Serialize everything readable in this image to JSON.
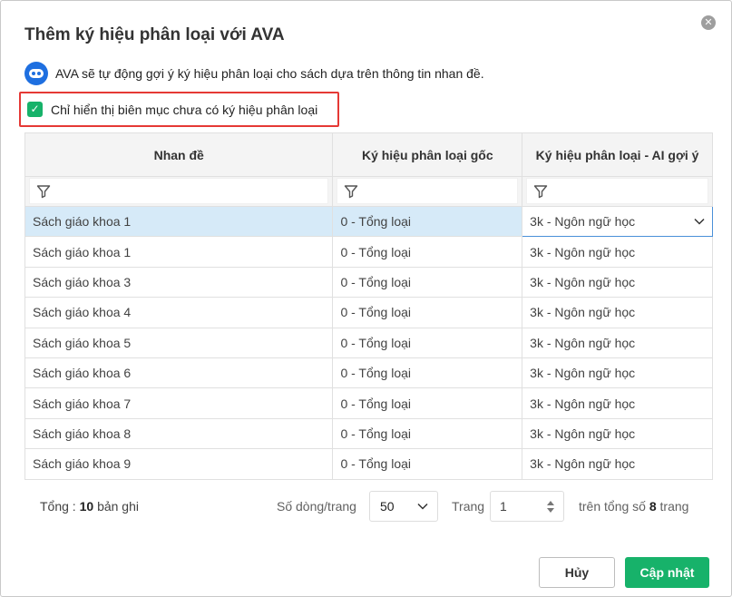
{
  "dialog": {
    "title": "Thêm ký hiệu phân loại với AVA",
    "close_icon": "close-icon",
    "intro_icon": "ava-robot-icon",
    "intro_text": "AVA sẽ tự động gợi ý ký hiệu phân loại cho sách dựa trên thông tin nhan đề.",
    "filter_checkbox": {
      "label": "Chỉ hiển thị biên mục chưa có ký hiệu phân loại",
      "checked": true
    }
  },
  "table": {
    "columns": [
      "Nhan đề",
      "Ký hiệu phân loại gốc",
      "Ký hiệu phân loại - AI gợi ý"
    ],
    "rows": [
      {
        "title": "Sách giáo khoa 1",
        "original": "0 - Tổng loại",
        "ai": "3k - Ngôn ngữ học"
      },
      {
        "title": "Sách giáo khoa 1",
        "original": "0 - Tổng loại",
        "ai": "3k - Ngôn ngữ học"
      },
      {
        "title": "Sách giáo khoa 3",
        "original": "0 - Tổng loại",
        "ai": "3k - Ngôn ngữ học"
      },
      {
        "title": "Sách giáo khoa 4",
        "original": "0 - Tổng loại",
        "ai": "3k - Ngôn ngữ học"
      },
      {
        "title": "Sách giáo khoa 5",
        "original": "0 - Tổng loại",
        "ai": "3k - Ngôn ngữ học"
      },
      {
        "title": "Sách giáo khoa 6",
        "original": "0 - Tổng loại",
        "ai": "3k - Ngôn ngữ học"
      },
      {
        "title": "Sách giáo khoa 7",
        "original": "0 - Tổng loại",
        "ai": "3k - Ngôn ngữ học"
      },
      {
        "title": "Sách giáo khoa 8",
        "original": "0 - Tổng loại",
        "ai": "3k - Ngôn ngữ học"
      },
      {
        "title": "Sách giáo khoa 9",
        "original": "0 - Tổng loại",
        "ai": "3k - Ngôn ngữ học"
      }
    ],
    "selected_row": 0
  },
  "footer": {
    "total_label": "Tổng :",
    "total_count": "10",
    "total_unit": "bản ghi",
    "rows_per_page_label": "Số dòng/trang",
    "rows_per_page_value": "50",
    "page_label": "Trang",
    "page_value": "1",
    "page_total_prefix": "trên tổng số",
    "page_total_count": "8",
    "page_total_suffix": "trang"
  },
  "buttons": {
    "cancel": "Hủy",
    "update": "Cập nhật"
  },
  "colors": {
    "accent": "#17b26a",
    "highlight": "#e53935",
    "selected_row": "#d6eaf8",
    "brand": "#1e6fe0"
  }
}
